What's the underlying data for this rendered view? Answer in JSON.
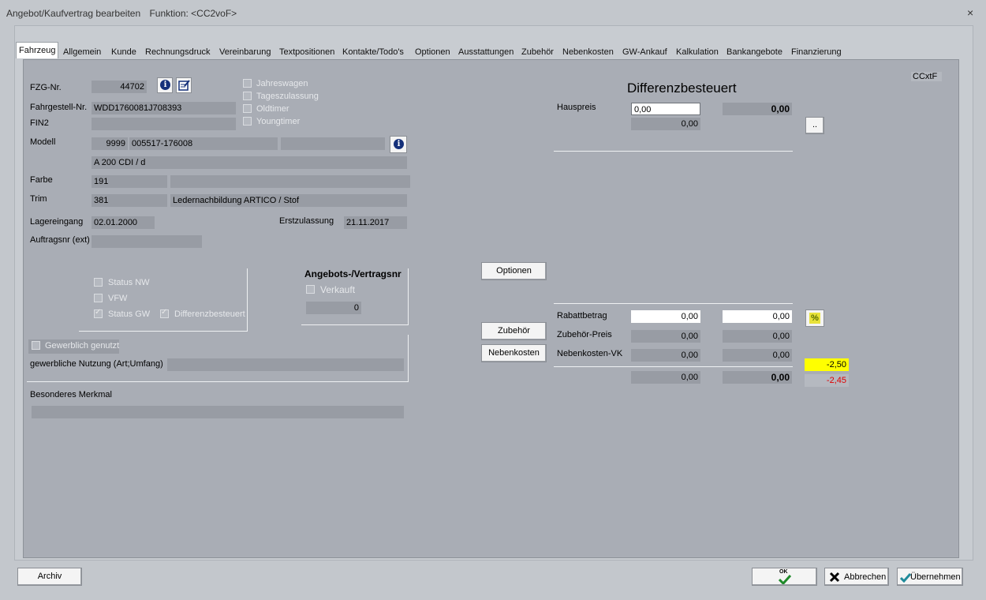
{
  "window": {
    "title": "Angebot/Kaufvertrag bearbeiten",
    "function": "Funktion: <CC2voF>",
    "close": "×"
  },
  "tabs": [
    "Fahrzeug",
    "Allgemein",
    "Kunde",
    "Rechnungsdruck",
    "Vereinbarung",
    "Textpositionen",
    "Kontakte/Todo's",
    "Optionen",
    "Ausstattungen",
    "Zubehör",
    "Nebenkosten",
    "GW-Ankauf",
    "Kalkulation",
    "Bankangebote",
    "Finanzierung"
  ],
  "vehicle": {
    "fzg_label": "FZG-Nr.",
    "fzg_value": "44702",
    "fahrgestell_label": "Fahrgestell-Nr.",
    "fahrgestell_value": "WDD1760081J708393",
    "fin2_label": "FIN2",
    "modell_label": "Modell",
    "modell_code": "9999",
    "modell_nr": "005517-176008",
    "modell_name": "A 200 CDI / d",
    "farbe_label": "Farbe",
    "farbe_code": "191",
    "trim_label": "Trim",
    "trim_code": "381",
    "trim_name": "Ledernachbildung ARTICO / Stof",
    "lager_label": "Lagereingang",
    "lager_value": "02.01.2000",
    "erst_label": "Erstzulassung",
    "erst_value": "21.11.2017",
    "auftrag_label": "Auftragsnr (ext)"
  },
  "flags": {
    "jahreswagen": "Jahreswagen",
    "tageszulassung": "Tageszulassung",
    "oldtimer": "Oldtimer",
    "youngtimer": "Youngtimer"
  },
  "status": {
    "nw": "Status NW",
    "vfw": "VFW",
    "gw": "Status GW",
    "diff": "Differenzbesteuert"
  },
  "contract": {
    "title": "Angebots-/Vertragsnr",
    "verkauft": "Verkauft",
    "number": "0"
  },
  "commercial": {
    "gewerblich": "Gewerblich genutzt",
    "nutzung_label": "gewerbliche Nutzung (Art;Umfang)"
  },
  "besonderes_label": "Besonderes Merkmal",
  "buttons": {
    "optionen": "Optionen",
    "zubehoer": "Zubehör",
    "nebenkosten": "Nebenkosten",
    "dots": "..",
    "archiv": "Archiv",
    "ok": "OK",
    "abbrechen": "Abbrechen",
    "uebernehmen": "Übernehmen"
  },
  "pricing": {
    "title": "Differenzbesteuert",
    "code": "CCxtF",
    "hauspreis_label": "Hauspreis",
    "hauspreis_input": "0,00",
    "hauspreis_right": "0,00",
    "hauspreis_second": "0,00",
    "rabatt_label": "Rabattbetrag",
    "rabatt_1": "0,00",
    "rabatt_2": "0,00",
    "zubehoer_label": "Zubehör-Preis",
    "zubehoer_1": "0,00",
    "zubehoer_2": "0,00",
    "neben_label": "Nebenkosten-VK",
    "neben_1": "0,00",
    "neben_2": "0,00",
    "total_1": "0,00",
    "total_2": "0,00",
    "pct_1": "-2,50",
    "pct_2": "-2,45"
  },
  "colors": {
    "highlight_yellow": "#ffff00",
    "negative_red": "#e00000"
  }
}
